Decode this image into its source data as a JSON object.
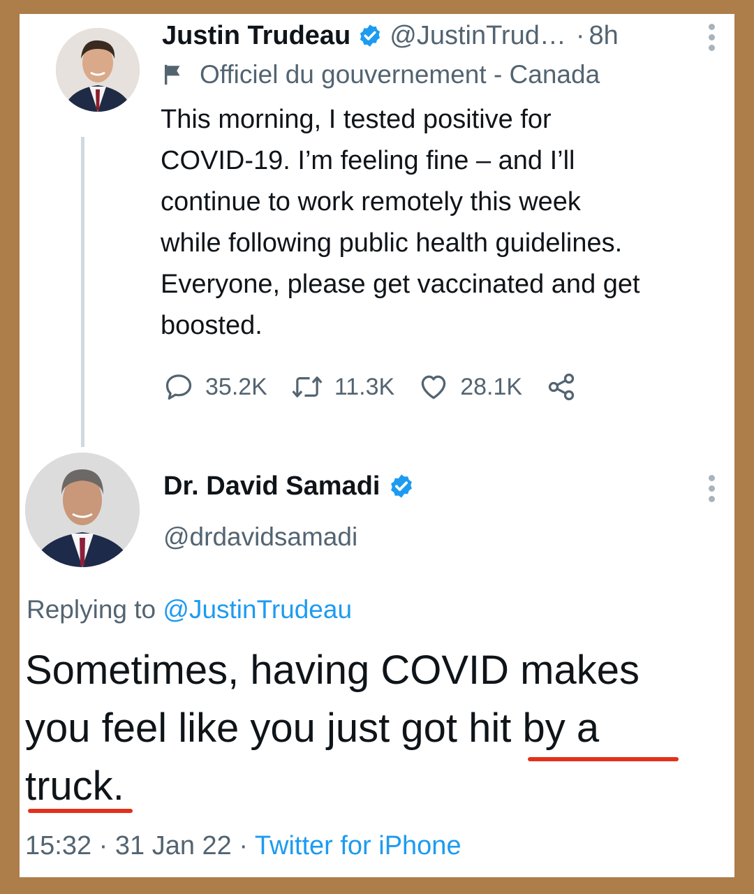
{
  "original_tweet": {
    "author_name": "Justin Trudeau",
    "handle": "@JustinTrud…",
    "separator": "·",
    "time": "8h",
    "government_label": "Officiel du gouvernement - Canada",
    "text": "This morning, I tested positive for COVID-19. I’m feeling fine – and I’ll continue to work remotely this week while following public health guidelines. Everyone, please get vaccinated and get boosted.",
    "text_lines": [
      "This morning, I tested positive for",
      "COVID-19. I’m feeling fine – and I’ll",
      "continue to work remotely this week",
      "while following public health guidelines.",
      "Everyone, please get vaccinated and get",
      "boosted."
    ],
    "replies": "35.2K",
    "retweets": "11.3K",
    "likes": "28.1K"
  },
  "reply_tweet": {
    "author_name": "Dr. David Samadi",
    "handle": "@drdavidsamadi",
    "replying_to_prefix": "Replying to",
    "replying_to_handle": "@JustinTrudeau",
    "text_line1": "Sometimes, having COVID makes",
    "text_line2_a": "you feel like you just got ",
    "text_line2_b": "hit by a",
    "text_line3_a": "truck",
    "text_line3_b": ".",
    "time": "15:32",
    "sep1": "·",
    "date": "31 Jan 22",
    "sep2": "·",
    "source": "Twitter for iPhone"
  },
  "colors": {
    "frame": "#ad7d4a",
    "verified": "#1d9bf0",
    "link": "#1d9bf0",
    "muted": "#536471",
    "thread_line": "#cfd9de",
    "underline": "#e2311b"
  }
}
